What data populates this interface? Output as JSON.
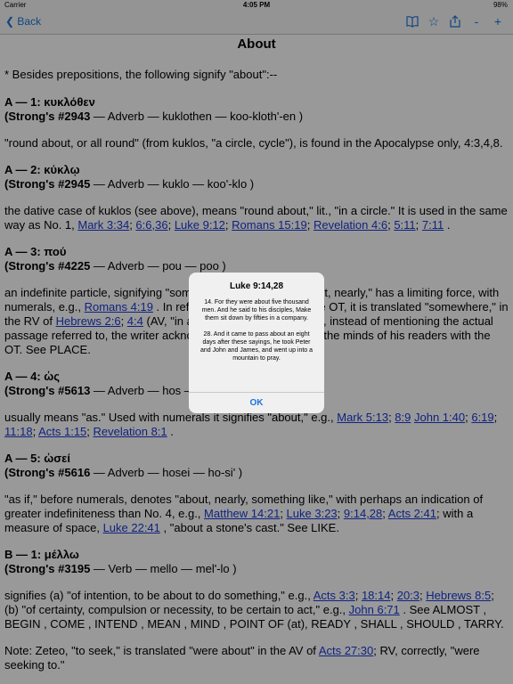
{
  "status": {
    "carrier": "Carrier",
    "time": "4:05 PM",
    "battery": "98%"
  },
  "nav": {
    "back_label": "Back",
    "icons": [
      "book-icon",
      "star-icon",
      "share-icon",
      "minus-icon",
      "plus-icon"
    ],
    "minus": "-",
    "plus": "+"
  },
  "page": {
    "title": "About",
    "intro": "* Besides prepositions, the following signify \"about\":--",
    "entries": [
      {
        "heading": "A — 1: κυκλόθεν",
        "strongs": "(Strong's #2943",
        "info": " — Adverb — kuklothen — koo-kloth'-en )",
        "body": "\"round about, or all round\" (from kuklos, \"a circle, cycle\"), is found in the Apocalypse only, 4:3,4,8."
      },
      {
        "heading": "A — 2: κύκλῳ",
        "strongs": "(Strong's #2945",
        "info": " — Adverb — kuklo — koo'-klo )",
        "body": "the dative case of kuklos (see above), means \"round about,\" lit., \"in a circle.\" It is used in the same way as No. 1, ",
        "refs": [
          "Mark 3:34",
          "6:6,36",
          "Luke 9:12",
          "Romans 15:19",
          "Revelation 4:6",
          "5:11",
          "7:11"
        ],
        "tail": " ."
      },
      {
        "heading": "A — 3: πού",
        "strongs": "(Strong's #4225",
        "info": " — Adverb — pou — poo )",
        "body1": "an indefinite particle, signifying \"somewhere, somewhere about, nearly,\" has a limiting force, with numerals, e.g., ",
        "ref1": "Romans 4:19",
        "body2": " . In reference to a passage in the OT, it is translated \"somewhere,\" in the RV of ",
        "ref2": "Hebrews 2:6",
        "ref3": "4:4",
        "body3": " (AV, \"in a certain place\"), the writer, instead of mentioning the actual passage referred to, the writer acknowledged the familiarity of the minds of his readers with the OT. See PLACE."
      },
      {
        "heading": "A — 4: ὡς",
        "strongs": "(Strong's #5613",
        "info": " — Adverb — hos — hoce )",
        "body": "usually means \"as.\" Used with numerals it signifies \"about,\" e.g., ",
        "refs": [
          "Mark 5:13",
          "8:9",
          "John 1:40",
          "6:19",
          "11:18",
          "Acts 1:15",
          "Revelation 8:1"
        ],
        "tail": " ."
      },
      {
        "heading": "A — 5: ὡσεί",
        "strongs": "(Strong's #5616",
        "info": " — Adverb — hosei — ho-si' )",
        "body": "\"as if,\" before numerals, denotes \"about, nearly, something like,\" with perhaps an indication of greater indefiniteness than No. 4, e.g., ",
        "refs": [
          "Matthew 14:21",
          "Luke 3:23",
          "9:14,28",
          "Acts 2:41"
        ],
        "mid": "; with a measure of space, ",
        "ref_last": "Luke 22:41",
        "tail": " , \"about a stone's cast.\" See LIKE."
      },
      {
        "heading": "B — 1: μέλλω",
        "strongs": "(Strong's #3195",
        "info": " — Verb — mello — mel'-lo )",
        "body1": "signifies (a) \"of intention, to be about to do something,\" e.g., ",
        "refs": [
          "Acts 3:3",
          "18:14",
          "20:3",
          "Hebrews 8:5"
        ],
        "body2": " (b) \"of certainty, compulsion or necessity, to be certain to act,\" e.g., ",
        "ref_b": "John 6:71",
        "tail": " . See ALMOST , BEGIN , COME , INTEND , MEAN , MIND , POINT OF (at), READY , SHALL , SHOULD , TARRY."
      }
    ],
    "note_prefix": "Note: Zeteo, \"to seek,\" is translated \"were about\" in the AV of ",
    "note_ref": "Acts 27:30",
    "note_suffix": "; RV, correctly, \"were seeking to.\""
  },
  "alert": {
    "title": "Luke 9:14,28",
    "verse1": "14. For they were about five thousand men. And he said to his disciples, Make them sit down by fifties in a company.",
    "verse2": "28. And it came to pass about an eight days after these sayings, he took Peter and John and James, and went up into a mountain to pray.",
    "ok_label": "OK"
  }
}
